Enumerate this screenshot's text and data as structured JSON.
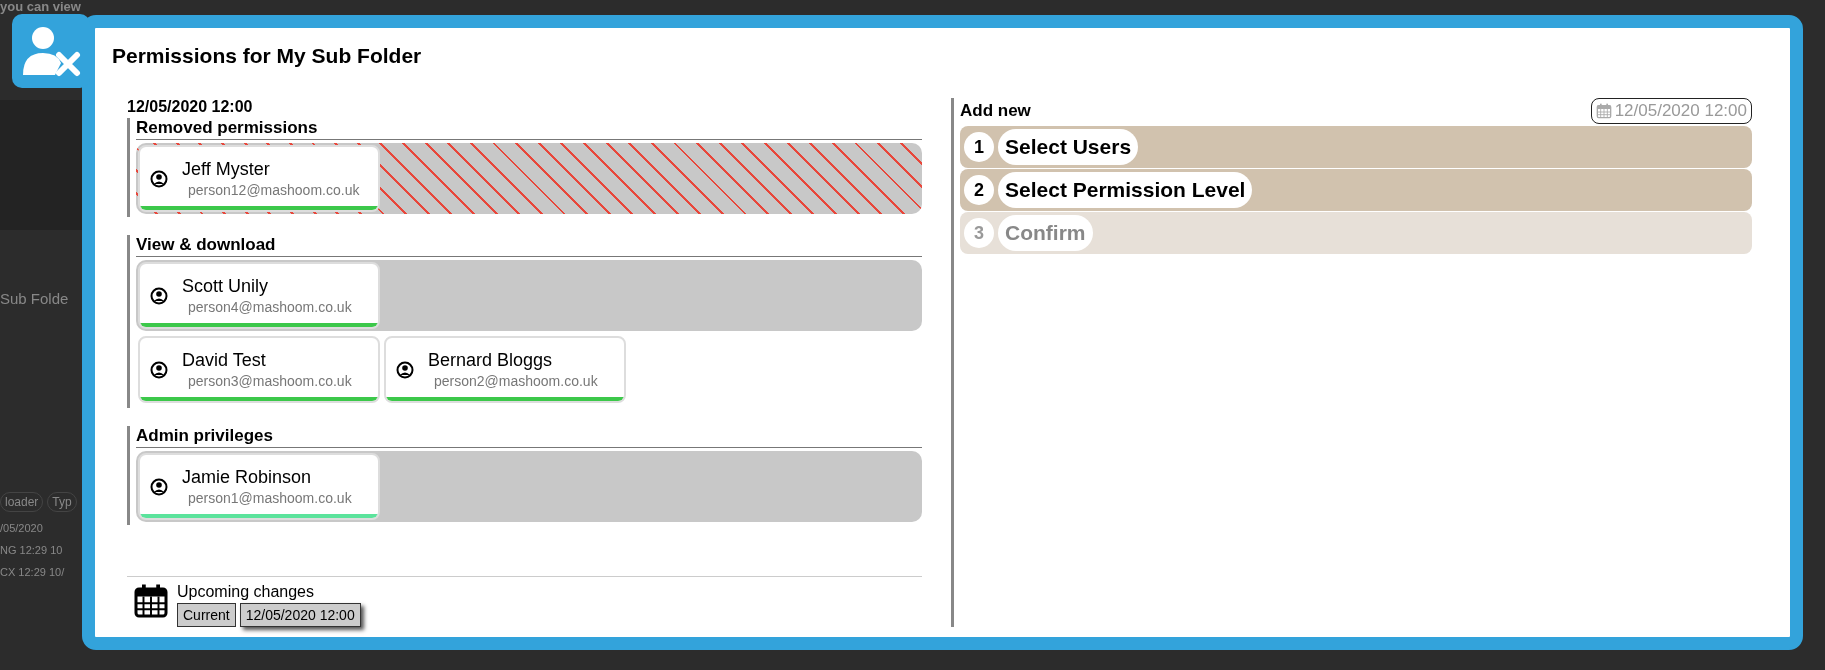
{
  "background": {
    "heading": "you can view",
    "folder": "Sub Folde",
    "columns": [
      "loader",
      "Typ"
    ],
    "rows": [
      "/05/2020",
      "NG 12:29 10",
      "CX 12:29 10/"
    ]
  },
  "dialog": {
    "title": "Permissions for My Sub Folder",
    "left": {
      "date": "12/05/2020 12:00",
      "sections": [
        {
          "title": "Removed permissions",
          "rows": [
            {
              "kind": "striped",
              "users": [
                {
                  "name": "Jeff Myster",
                  "email": "person12@mashoom.co.uk",
                  "color": "#3cc84a"
                }
              ]
            }
          ]
        },
        {
          "title": "View & download",
          "rows": [
            {
              "kind": "shaded",
              "users": [
                {
                  "name": "Scott Unily",
                  "email": "person4@mashoom.co.uk",
                  "color": "#3cc84a"
                }
              ]
            },
            {
              "kind": "plain",
              "users": [
                {
                  "name": "David Test",
                  "email": "person3@mashoom.co.uk",
                  "color": "#3cc84a"
                },
                {
                  "name": "Bernard Bloggs",
                  "email": "person2@mashoom.co.uk",
                  "color": "#3cc84a"
                }
              ]
            }
          ]
        },
        {
          "title": "Admin privileges",
          "rows": [
            {
              "kind": "shaded",
              "users": [
                {
                  "name": "Jamie Robinson",
                  "email": "person1@mashoom.co.uk",
                  "color": "#5be39c"
                }
              ]
            }
          ]
        }
      ],
      "upcoming": {
        "label": "Upcoming changes",
        "options": [
          {
            "label": "Current",
            "selected": false
          },
          {
            "label": "12/05/2020 12:00",
            "selected": true
          }
        ]
      }
    },
    "right": {
      "title": "Add new",
      "date": "12/05/2020 12:00",
      "steps": [
        {
          "number": "1",
          "label": "Select Users",
          "disabled": false
        },
        {
          "number": "2",
          "label": "Select Permission Level",
          "disabled": false
        },
        {
          "number": "3",
          "label": "Confirm",
          "disabled": true
        }
      ]
    }
  }
}
